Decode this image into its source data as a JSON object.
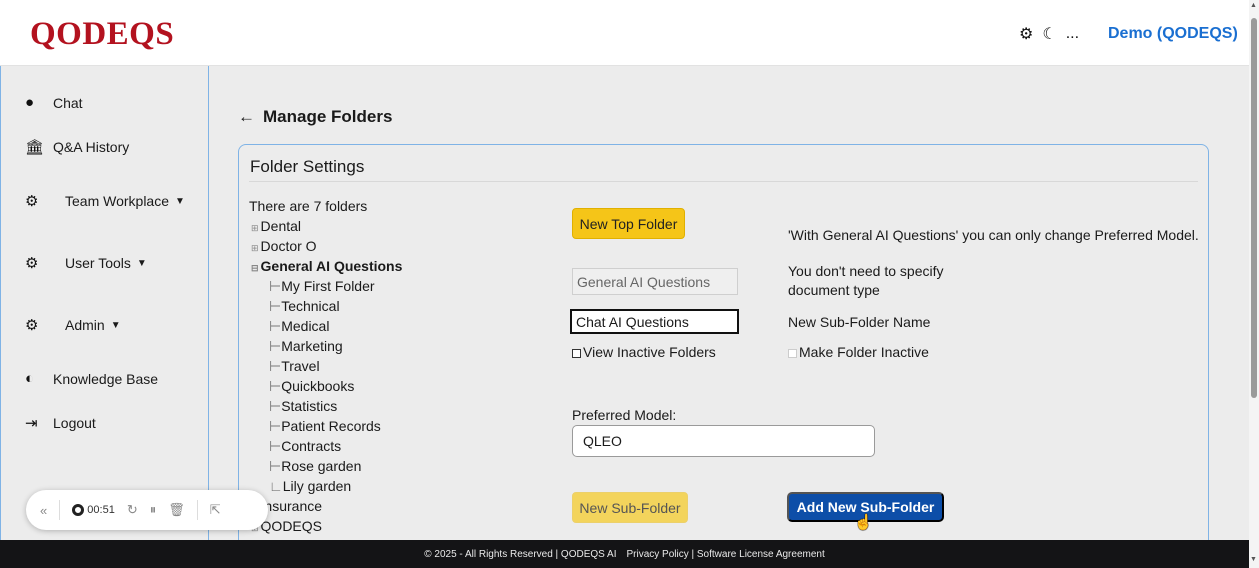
{
  "header": {
    "logo": "QODEQS",
    "icons": [
      "gear-icon",
      "moon-icon",
      "ellipsis-icon"
    ],
    "ellipsis": "...",
    "user": "Demo (QODEQS)"
  },
  "sidebar": {
    "items": [
      {
        "label": "Chat",
        "icon": "chat-bubble-icon",
        "glyph": "●"
      },
      {
        "label": "Q&A History",
        "icon": "bank-icon",
        "glyph": "🏛"
      },
      {
        "label": "Team Workplace",
        "icon": "gears-icon",
        "glyph": "⚙",
        "dropdown": true
      },
      {
        "label": "User Tools",
        "icon": "gears-icon",
        "glyph": "⚙",
        "dropdown": true
      },
      {
        "label": "Admin",
        "icon": "gears-icon",
        "glyph": "⚙",
        "dropdown": true
      },
      {
        "label": "Knowledge Base",
        "icon": "brain-icon",
        "glyph": "◐"
      },
      {
        "label": "Logout",
        "icon": "logout-icon",
        "glyph": "⇥"
      }
    ]
  },
  "page": {
    "back_arrow": "←",
    "title": "Manage Folders"
  },
  "card": {
    "title": "Folder Settings",
    "folder_count": "There are 7 folders",
    "tree": [
      {
        "label": "Dental",
        "level": 0,
        "expander": "⊞"
      },
      {
        "label": "Doctor O",
        "level": 0,
        "expander": "⊞"
      },
      {
        "label": "General AI Questions",
        "level": 0,
        "expander": "⊟",
        "bold": true
      },
      {
        "label": "My First Folder",
        "level": 1
      },
      {
        "label": "Technical",
        "level": 1
      },
      {
        "label": "Medical",
        "level": 1
      },
      {
        "label": "Marketing",
        "level": 1
      },
      {
        "label": "Travel",
        "level": 1
      },
      {
        "label": "Quickbooks",
        "level": 1
      },
      {
        "label": "Statistics",
        "level": 1
      },
      {
        "label": "Patient Records",
        "level": 1
      },
      {
        "label": "Contracts",
        "level": 1
      },
      {
        "label": "Rose garden",
        "level": 1
      },
      {
        "label": "Lily garden",
        "level": 1,
        "last": true
      },
      {
        "label": "Insurance",
        "level": 0,
        "expander": "⊞"
      },
      {
        "label": "QODEQS",
        "level": 0,
        "expander": "⊞"
      }
    ],
    "new_top_folder": "New Top Folder",
    "info_text": "'With General AI Questions' you can only change Preferred Model.",
    "selected_folder_value": "General AI Questions",
    "doc_type_note_line1": "You don't need to specify",
    "doc_type_note_line2": "document type",
    "subfolder_name_value": "Chat AI Questions",
    "subfolder_name_label": "New Sub-Folder Name",
    "view_inactive_label": "View Inactive Folders",
    "make_inactive_label": "Make Folder Inactive",
    "preferred_model_label": "Preferred Model:",
    "preferred_model_value": "QLEO",
    "new_subfolder_button": "New Sub-Folder",
    "add_subfolder_button": "Add New Sub-Folder"
  },
  "footer": {
    "copyright": "© 2025 - All Rights Reserved | QODEQS AI",
    "links": "Privacy Policy | Software License Agreement"
  },
  "recorder": {
    "collapse": "«",
    "time": "00:51",
    "restart_icon": "↻",
    "pause_icon": "⏸",
    "delete_icon": "🗑",
    "pointer_icon": "⇱"
  },
  "colors": {
    "brand_red": "#b3121f",
    "accent_blue": "#1a6fd1",
    "button_yellow": "#f5c518",
    "button_blue": "#0d4ea8",
    "footer_bg": "#141416"
  }
}
